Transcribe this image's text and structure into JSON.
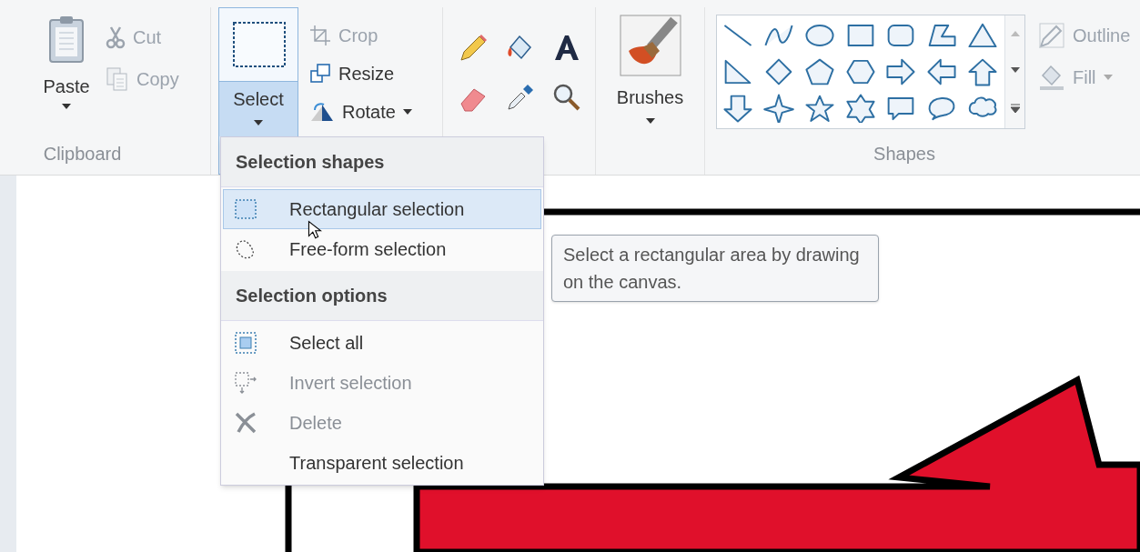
{
  "clipboard": {
    "paste": {
      "label": "Paste"
    },
    "cut": {
      "label": "Cut",
      "disabled": true
    },
    "copy": {
      "label": "Copy",
      "disabled": true
    },
    "group_label": "Clipboard"
  },
  "image": {
    "select": {
      "label": "Select",
      "open": true
    },
    "crop": {
      "label": "Crop",
      "disabled": true
    },
    "resize": {
      "label": "Resize",
      "disabled": false
    },
    "rotate": {
      "label": "Rotate",
      "disabled": false
    }
  },
  "brushes": {
    "label": "Brushes"
  },
  "shapes": {
    "outline": {
      "label": "Outline",
      "disabled": true
    },
    "fill": {
      "label": "Fill",
      "disabled": true
    },
    "group_label": "Shapes"
  },
  "select_menu": {
    "sections": [
      {
        "heading": "Selection shapes",
        "items": [
          {
            "label": "Rectangular selection",
            "selected": true,
            "disabled": false
          },
          {
            "label": "Free-form selection",
            "selected": false,
            "disabled": false
          }
        ]
      },
      {
        "heading": "Selection options",
        "items": [
          {
            "label": "Select all",
            "selected": false,
            "disabled": false
          },
          {
            "label": "Invert selection",
            "selected": false,
            "disabled": true
          },
          {
            "label": "Delete",
            "selected": false,
            "disabled": true
          },
          {
            "label": "Transparent selection",
            "selected": false,
            "disabled": false
          }
        ]
      }
    ]
  },
  "tooltip": {
    "text": "Select a rectangular area by drawing on the canvas."
  }
}
